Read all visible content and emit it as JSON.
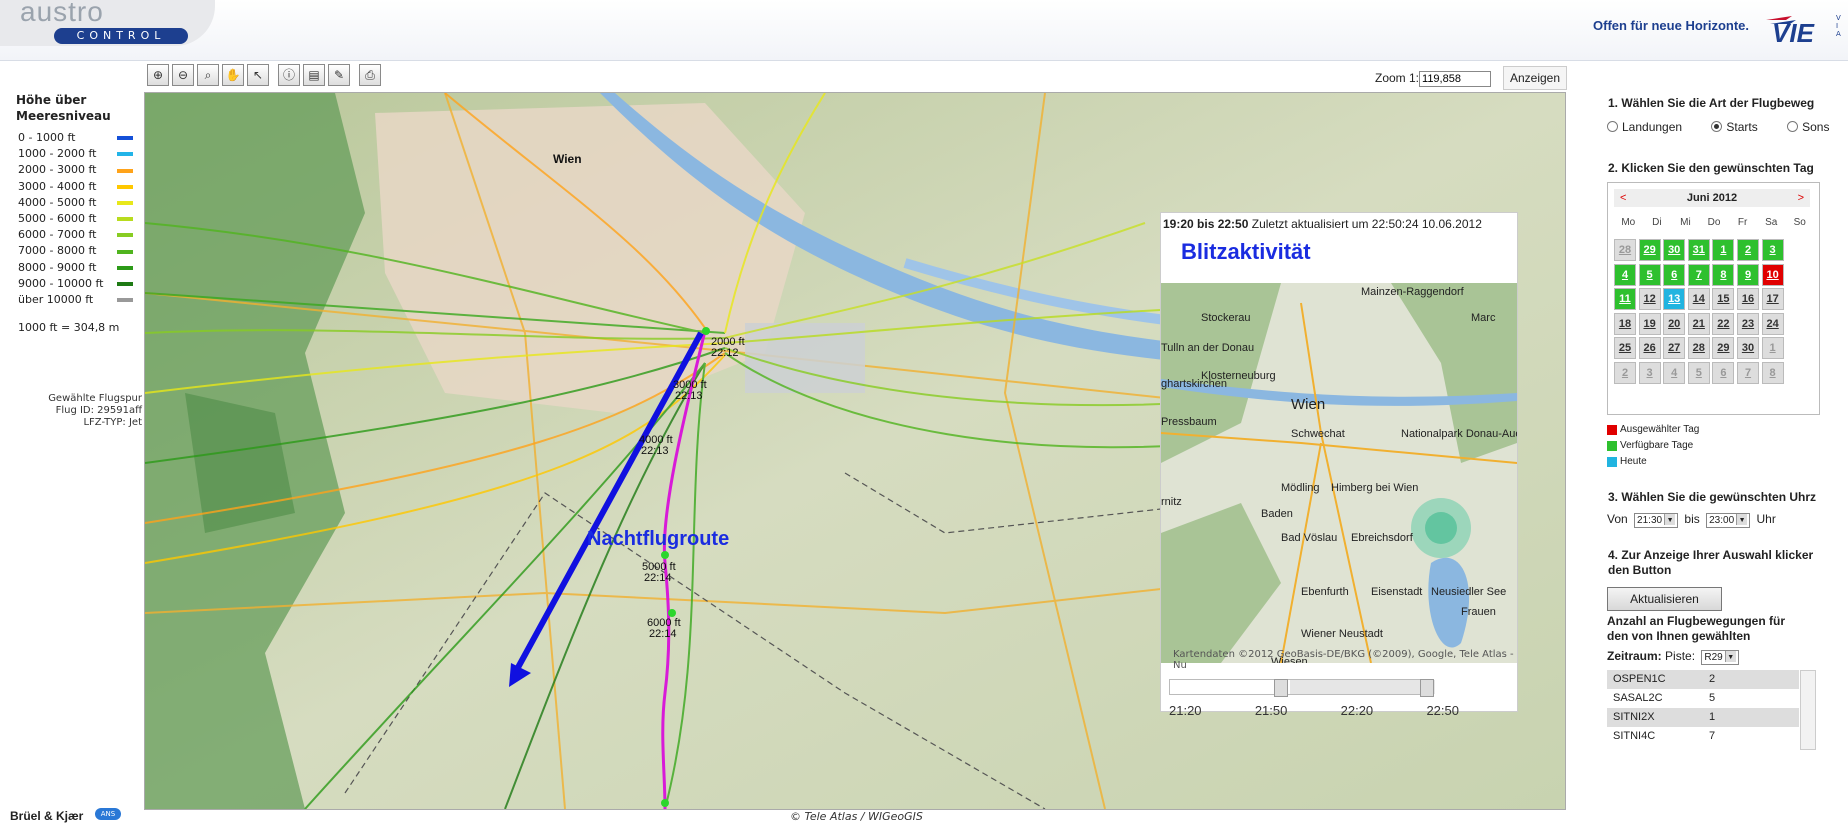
{
  "header": {
    "logo_word": "austro",
    "logo_pill": "CONTROL",
    "slogan": "Offen für neue Horizonte.",
    "partner_logo": "VIE"
  },
  "toolbar": {
    "icons": [
      "zoom-in-icon",
      "zoom-out-icon",
      "zoom-box-icon",
      "pan-hand-icon",
      "pointer-icon",
      "info-icon",
      "bookmark-icon",
      "measure-icon",
      "print-icon"
    ]
  },
  "zoom": {
    "label": "Zoom 1:",
    "value": "119,858",
    "button": "Anzeigen"
  },
  "legend": {
    "title_line1": "Höhe über",
    "title_line2": "Meeresniveau",
    "rows": [
      {
        "label": "0  -  1000 ft",
        "color": "#1450d8"
      },
      {
        "label": "1000  -  2000 ft",
        "color": "#22b4e8"
      },
      {
        "label": "2000  -  3000 ft",
        "color": "#ffa31a"
      },
      {
        "label": "3000  -  4000 ft",
        "color": "#ffc800"
      },
      {
        "label": "4000  -  5000 ft",
        "color": "#e8e81a"
      },
      {
        "label": "5000  -  6000 ft",
        "color": "#b8dc1e"
      },
      {
        "label": "6000  -  7000 ft",
        "color": "#88cc22"
      },
      {
        "label": "7000  -  8000 ft",
        "color": "#50b41e"
      },
      {
        "label": "8000  -  9000 ft",
        "color": "#2c9a18"
      },
      {
        "label": "9000 - 10000 ft",
        "color": "#1e7a14"
      },
      {
        "label": "über  10000 ft",
        "color": "#999999"
      }
    ],
    "conversion": "1000 ft = 304,8 m"
  },
  "flight_info": {
    "line1": "Gewählte Flugspur",
    "line2": "Flug ID: 29591aff",
    "line3": "LFZ-TYP: Jet"
  },
  "map": {
    "labels": {
      "alt1": "2000 ft",
      "time1": "22:12",
      "alt2": "3000 ft",
      "time2": "22:13",
      "alt3": "4000 ft",
      "time3": "22:13",
      "alt4": "5000 ft",
      "time4": "22:14",
      "alt5": "6000 ft",
      "time5": "22:14",
      "route": "Nachtflugroute",
      "city": "Wien"
    },
    "copyright": "© Tele Atlas / WIGeoGIS"
  },
  "inset": {
    "range": "19:20 bis 22:50",
    "updated": "Zuletzt aktualisiert um 22:50:24 10.06.2012",
    "title": "Blitzaktivität",
    "places": [
      "Stockerau",
      "Tulln an der Donau",
      "Klosterneuburg",
      "ghartskirchen",
      "Wien",
      "Pressbaum",
      "Schwechat",
      "Nationalpark Donau-Auen",
      "Mödling",
      "Himberg bei Wien",
      "Baden",
      "Bad Vöslau",
      "Ebreichsdorf",
      "Ebenfurth",
      "Eisenstadt",
      "Wiener Neustadt",
      "Neusiedler See",
      "Frauen",
      "Marc",
      "rnitz",
      "Wiesen",
      "Mainzen-Raggendorf"
    ],
    "copyright": "Kartendaten ©2012 GeoBasis-DE/BKG (©2009), Google, Tele Atlas - Nu",
    "ticks": [
      "21:20",
      "21:50",
      "22:20",
      "22:50"
    ]
  },
  "panel": {
    "step1": "1. Wählen Sie die Art  der Flugbeweg",
    "radios": [
      {
        "label": "Landungen",
        "checked": false
      },
      {
        "label": "Starts",
        "checked": true
      },
      {
        "label": "Sons",
        "checked": false
      }
    ],
    "step2": "2. Klicken Sie den gewünschten Tag",
    "calendar": {
      "month": "Juni 2012",
      "prev": "<",
      "next": ">",
      "dow": [
        "Mo",
        "Di",
        "Mi",
        "Do",
        "Fr",
        "Sa",
        "So"
      ],
      "weeks": [
        [
          {
            "d": "28",
            "s": "other"
          },
          {
            "d": "29",
            "s": "avail"
          },
          {
            "d": "30",
            "s": "avail"
          },
          {
            "d": "31",
            "s": "avail"
          },
          {
            "d": "1",
            "s": "avail"
          },
          {
            "d": "2",
            "s": "avail"
          },
          {
            "d": "3",
            "s": "avail"
          }
        ],
        [
          {
            "d": "4",
            "s": "avail"
          },
          {
            "d": "5",
            "s": "avail"
          },
          {
            "d": "6",
            "s": "avail"
          },
          {
            "d": "7",
            "s": "avail"
          },
          {
            "d": "8",
            "s": "avail"
          },
          {
            "d": "9",
            "s": "avail"
          },
          {
            "d": "10",
            "s": "sel"
          }
        ],
        [
          {
            "d": "11",
            "s": "avail"
          },
          {
            "d": "12",
            "s": "plain"
          },
          {
            "d": "13",
            "s": "today"
          },
          {
            "d": "14",
            "s": "plain"
          },
          {
            "d": "15",
            "s": "plain"
          },
          {
            "d": "16",
            "s": "plain"
          },
          {
            "d": "17",
            "s": "plain"
          }
        ],
        [
          {
            "d": "18",
            "s": "plain"
          },
          {
            "d": "19",
            "s": "plain"
          },
          {
            "d": "20",
            "s": "plain"
          },
          {
            "d": "21",
            "s": "plain"
          },
          {
            "d": "22",
            "s": "plain"
          },
          {
            "d": "23",
            "s": "plain"
          },
          {
            "d": "24",
            "s": "plain"
          }
        ],
        [
          {
            "d": "25",
            "s": "plain"
          },
          {
            "d": "26",
            "s": "plain"
          },
          {
            "d": "27",
            "s": "plain"
          },
          {
            "d": "28",
            "s": "plain"
          },
          {
            "d": "29",
            "s": "plain"
          },
          {
            "d": "30",
            "s": "plain"
          },
          {
            "d": "1",
            "s": "other"
          }
        ],
        [
          {
            "d": "2",
            "s": "other"
          },
          {
            "d": "3",
            "s": "other"
          },
          {
            "d": "4",
            "s": "other"
          },
          {
            "d": "5",
            "s": "other"
          },
          {
            "d": "6",
            "s": "other"
          },
          {
            "d": "7",
            "s": "other"
          },
          {
            "d": "8",
            "s": "other"
          }
        ]
      ]
    },
    "key_selected": "Ausgewählter Tag",
    "key_available": "Verfügbare Tage",
    "key_today": "Heute",
    "step3": "3. Wählen Sie die gewünschten Uhrz",
    "von": "Von",
    "from_time": "21:30",
    "bis": "bis",
    "to_time": "23:00",
    "uhr": "Uhr",
    "step4_line1": "4. Zur Anzeige Ihrer Auswahl klicker",
    "step4_line2": "den Button",
    "button": "Aktualisieren",
    "count_line1": "Anzahl an Flugbewegungen für",
    "count_line2": "den von Ihnen gewählten",
    "zeitraum": "Zeitraum:",
    "piste_label": "Piste:",
    "piste": "R29",
    "routes": [
      {
        "name": "OSPEN1C",
        "count": "2"
      },
      {
        "name": "SASAL2C",
        "count": "5"
      },
      {
        "name": "SITNI2X",
        "count": "1"
      },
      {
        "name": "SITNI4C",
        "count": "7"
      }
    ]
  },
  "footer": {
    "brand": "Brüel & Kjær"
  },
  "colors": {
    "brand": "#1d3f8f",
    "available": "#2ec02e",
    "selected": "#e00000",
    "today": "#21b4e0"
  }
}
